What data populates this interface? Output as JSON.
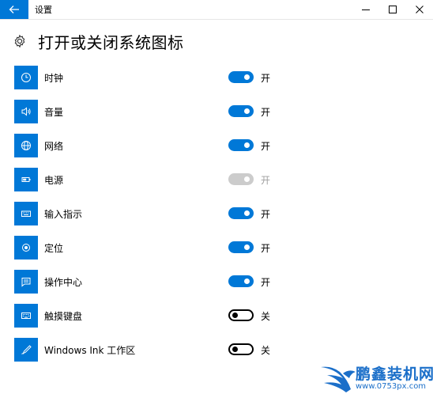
{
  "window": {
    "title": "设置"
  },
  "page": {
    "title": "打开或关闭系统图标"
  },
  "items": [
    {
      "label": "时钟",
      "state": "开",
      "toggle": "on",
      "icon": "clock-icon"
    },
    {
      "label": "音量",
      "state": "开",
      "toggle": "on",
      "icon": "volume-icon"
    },
    {
      "label": "网络",
      "state": "开",
      "toggle": "on",
      "icon": "network-globe-icon"
    },
    {
      "label": "电源",
      "state": "开",
      "toggle": "disabled",
      "icon": "battery-icon"
    },
    {
      "label": "输入指示",
      "state": "开",
      "toggle": "on",
      "icon": "keyboard-icon"
    },
    {
      "label": "定位",
      "state": "开",
      "toggle": "on",
      "icon": "location-icon"
    },
    {
      "label": "操作中心",
      "state": "开",
      "toggle": "on",
      "icon": "action-center-icon"
    },
    {
      "label": "触摸键盘",
      "state": "关",
      "toggle": "off",
      "icon": "touch-keyboard-icon"
    },
    {
      "label": "Windows Ink 工作区",
      "state": "关",
      "toggle": "off",
      "icon": "pen-ink-icon"
    }
  ],
  "watermark": {
    "brand": "鹏鑫装机网",
    "url": "www.0753px.com"
  },
  "colors": {
    "accent": "#0078d7",
    "disabled": "#cccccc",
    "watermark": "#1b6fc9"
  }
}
